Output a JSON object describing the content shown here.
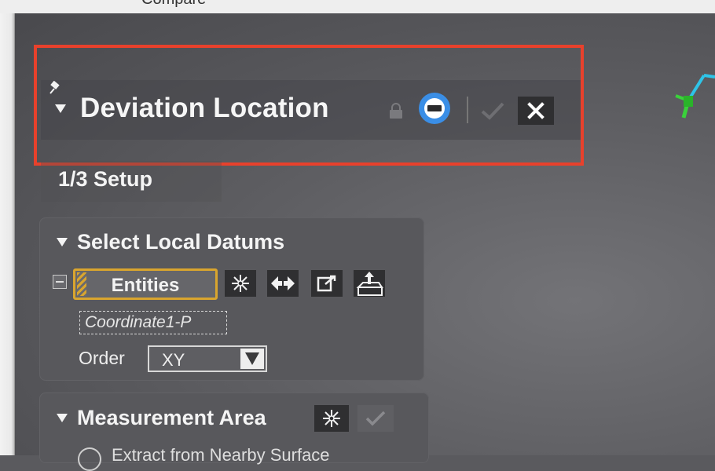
{
  "app": {
    "tab_partial_text": "Compare"
  },
  "header": {
    "title": "Deviation Location",
    "close_symbol": "✕",
    "colors": {
      "highlight": "#e8412c",
      "record_blue": "#3a8ee6"
    }
  },
  "step": {
    "label": "1/3 Setup"
  },
  "select_local_datums": {
    "title": "Select Local Datums",
    "entities_button": "Entities",
    "coordinate_value": "Coordinate1-P",
    "order_label": "Order",
    "order_value": "XY",
    "toolbar_icons": [
      "pick-icon",
      "flip-arrows-icon",
      "export-icon",
      "datum-icon"
    ]
  },
  "measurement_area": {
    "title": "Measurement Area",
    "option_partial": "Extract from Nearby Surface"
  }
}
